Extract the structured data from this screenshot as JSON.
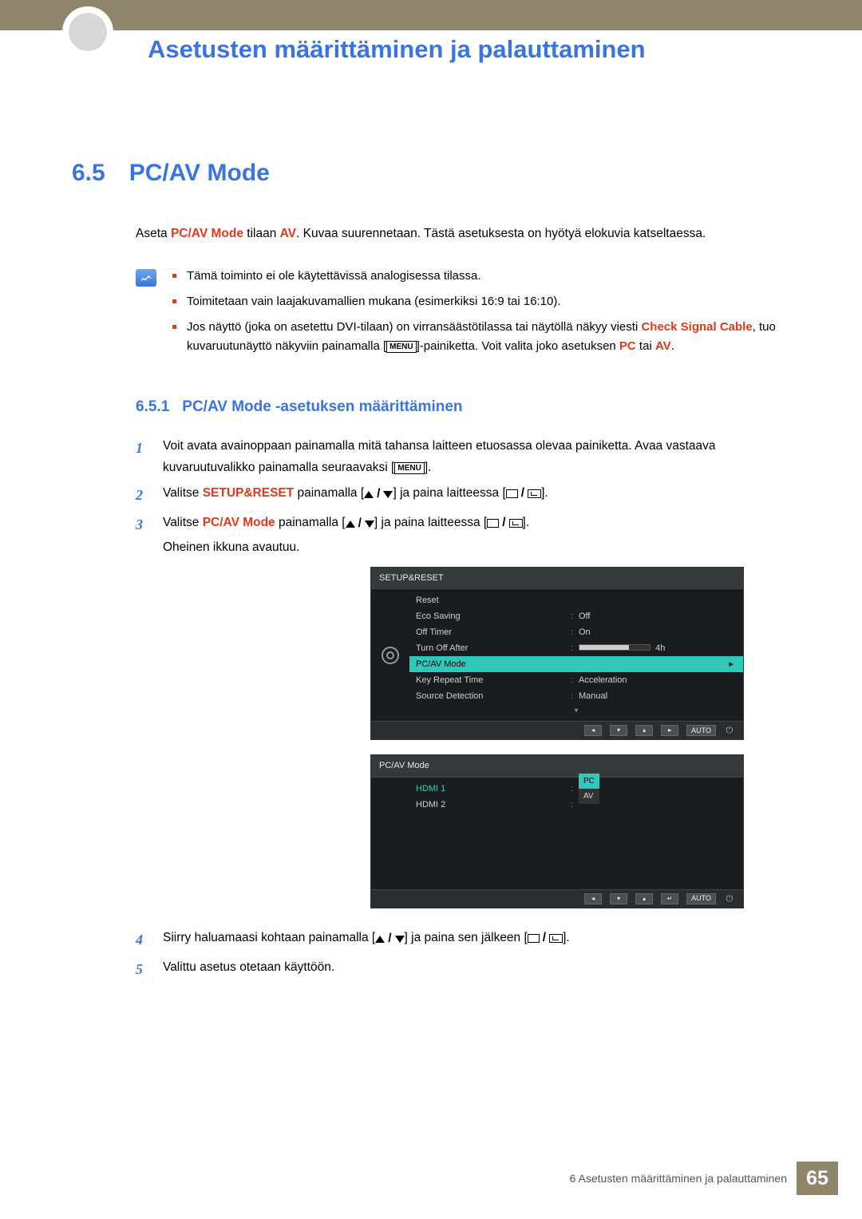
{
  "header": {
    "chapter_title": "Asetusten määrittäminen ja palauttaminen"
  },
  "section": {
    "number": "6.5",
    "title": "PC/AV Mode"
  },
  "intro": {
    "prefix": "Aseta ",
    "bold1": "PC/AV Mode",
    "mid": " tilaan ",
    "bold2": "AV",
    "suffix": ". Kuvaa suurennetaan. Tästä asetuksesta on hyötyä elokuvia katseltaessa."
  },
  "notes": {
    "b1": "Tämä toiminto ei ole käytettävissä analogisessa tilassa.",
    "b2": "Toimitetaan vain laajakuvamallien mukana (esimerkiksi 16:9 tai 16:10).",
    "b3_a": "Jos näyttö (joka on asetettu DVI-tilaan) on virransäästötilassa tai näytöllä näkyy viesti ",
    "b3_red1": "Check Signal Cable",
    "b3_b": ", tuo kuvaruutunäyttö näkyviin painamalla [",
    "b3_menu": "MENU",
    "b3_c": "]-painiketta. Voit valita joko asetuksen ",
    "b3_red2": "PC",
    "b3_d": " tai ",
    "b3_red3": "AV",
    "b3_e": "."
  },
  "subsection": {
    "number": "6.5.1",
    "title": "PC/AV Mode -asetuksen määrittäminen"
  },
  "steps": {
    "s1": "Voit avata avainoppaan painamalla mitä tahansa laitteen etuosassa olevaa painiketta. Avaa vastaava kuvaruutuvalikko painamalla seuraavaksi [",
    "s1_menu": "MENU",
    "s1_end": "].",
    "s2_a": "Valitse ",
    "s2_red": "SETUP&RESET",
    "s2_b": " painamalla [",
    "s2_c": "] ja paina laitteessa [",
    "s2_d": "].",
    "s3_a": "Valitse ",
    "s3_red": "PC/AV Mode",
    "s3_b": " painamalla [",
    "s3_c": "] ja paina laitteessa [",
    "s3_d": "].",
    "s3_e": "Oheinen ikkuna avautuu.",
    "s4_a": "Siirry haluamaasi kohtaan painamalla [",
    "s4_b": "] ja paina sen jälkeen [",
    "s4_c": "].",
    "s5": "Valittu asetus otetaan käyttöön."
  },
  "osd1": {
    "title": "SETUP&RESET",
    "rows": {
      "reset": "Reset",
      "eco": "Eco Saving",
      "eco_v": "Off",
      "offt": "Off Timer",
      "offt_v": "On",
      "toa": "Turn Off After",
      "toa_v": "4h",
      "pcav": "PC/AV Mode",
      "krt": "Key Repeat Time",
      "krt_v": "Acceleration",
      "sd": "Source Detection",
      "sd_v": "Manual"
    },
    "auto": "AUTO"
  },
  "osd2": {
    "title": "PC/AV Mode",
    "hdmi1": "HDMI 1",
    "hdmi2": "HDMI 2",
    "opt_pc": "PC",
    "opt_av": "AV",
    "auto": "AUTO"
  },
  "footer": {
    "chapter_label": "6 Asetusten määrittäminen ja palauttaminen",
    "page_number": "65"
  }
}
